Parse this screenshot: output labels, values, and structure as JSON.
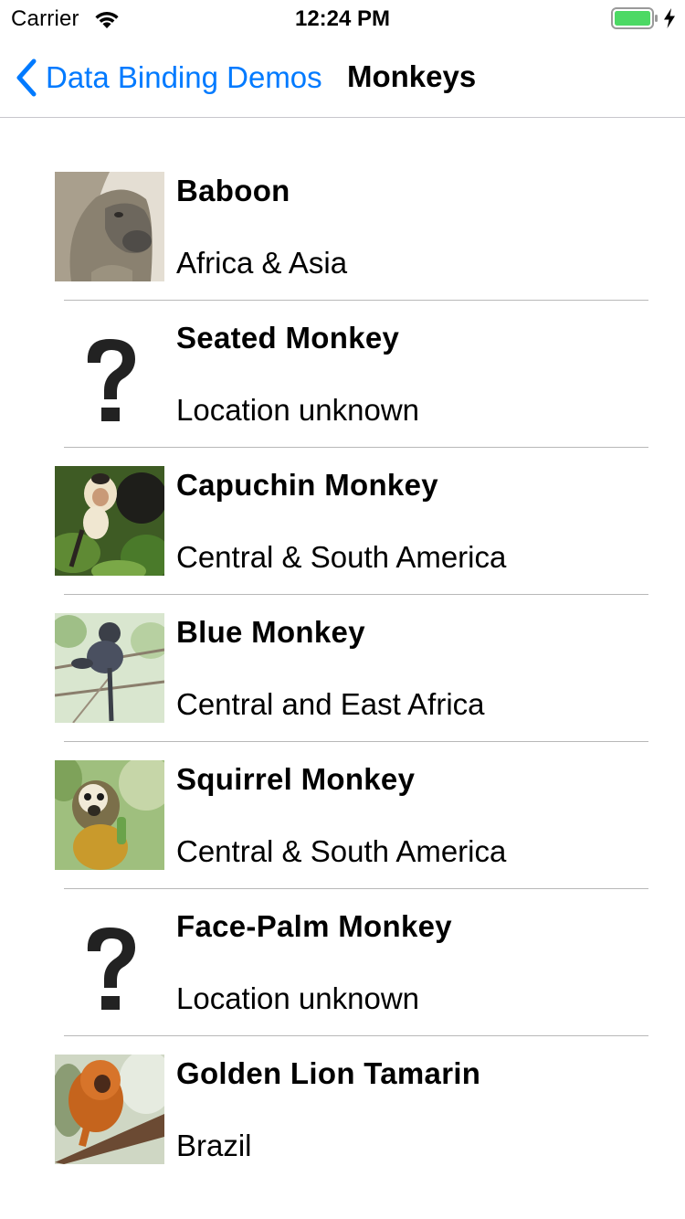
{
  "status_bar": {
    "carrier": "Carrier",
    "time": "12:24 PM",
    "wifi_icon": "wifi-icon",
    "battery_icon": "battery-icon",
    "charging_icon": "charging-bolt-icon",
    "battery_color": "#4cd964"
  },
  "nav": {
    "back_label": "Data Binding Demos",
    "back_icon": "chevron-left-icon",
    "title": "Monkeys",
    "accent_color": "#007aff"
  },
  "monkeys": [
    {
      "name": "Baboon",
      "location": "Africa & Asia",
      "image": "baboon-photo"
    },
    {
      "name": "Seated Monkey",
      "location": "Location unknown",
      "image": "question-mark-placeholder"
    },
    {
      "name": "Capuchin Monkey",
      "location": "Central & South America",
      "image": "capuchin-photo"
    },
    {
      "name": "Blue Monkey",
      "location": "Central and East Africa",
      "image": "blue-monkey-photo"
    },
    {
      "name": "Squirrel Monkey",
      "location": "Central & South America",
      "image": "squirrel-monkey-photo"
    },
    {
      "name": "Face-Palm Monkey",
      "location": "Location unknown",
      "image": "question-mark-placeholder"
    },
    {
      "name": "Golden Lion Tamarin",
      "location": "Brazil",
      "image": "golden-lion-tamarin-photo"
    }
  ]
}
